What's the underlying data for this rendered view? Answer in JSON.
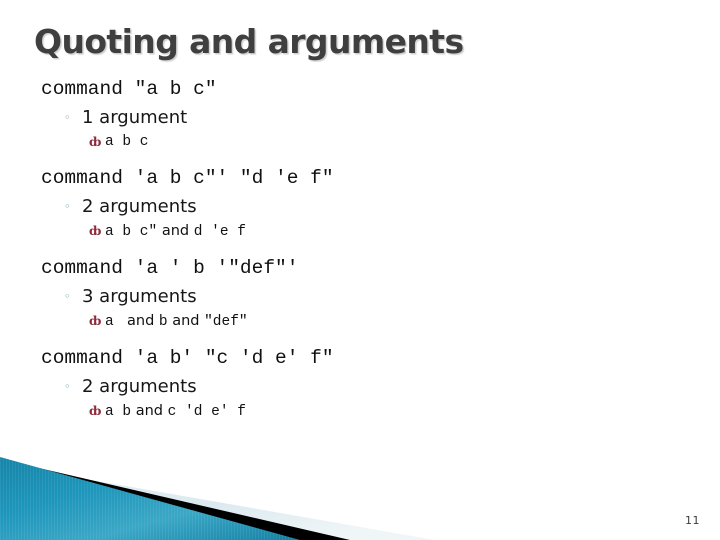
{
  "slide": {
    "title": "Quoting and arguments",
    "page_number": "11",
    "theme": {
      "title_color": "#3f3f3f",
      "body_color": "#111111",
      "bullet2_color": "#5f8fa0",
      "bullet3_color": "#8e2a39",
      "accent_teal": "#1a90b4",
      "accent_teal_dark": "#14708f",
      "accent_light": "#dbe8ee",
      "accent_black": "#000000",
      "background": "#ffffff"
    },
    "bullet_glyphs": {
      "level2": "◦",
      "level3": "ȸ"
    }
  },
  "blocks": [
    {
      "command": "command \"a b c\"",
      "count_label": "1 argument",
      "result_parts": [
        {
          "type": "code",
          "text": "a b c"
        }
      ]
    },
    {
      "command": "command 'a b c\"' \"d 'e f\"",
      "count_label": "2 arguments",
      "result_parts": [
        {
          "type": "code",
          "text": "a b c\""
        },
        {
          "type": "and",
          "text": " and "
        },
        {
          "type": "code",
          "text": "d 'e f"
        }
      ]
    },
    {
      "command": "command 'a ' b '\"def\"'",
      "count_label": "3 arguments",
      "result_parts": [
        {
          "type": "code",
          "text": "a "
        },
        {
          "type": "and",
          "text": " and "
        },
        {
          "type": "code",
          "text": "b"
        },
        {
          "type": "and",
          "text": " and "
        },
        {
          "type": "code",
          "text": "\"def\""
        }
      ]
    },
    {
      "command": "command 'a b' \"c 'd e' f\"",
      "count_label": "2 arguments",
      "result_parts": [
        {
          "type": "code",
          "text": "a b"
        },
        {
          "type": "and",
          "text": " and "
        },
        {
          "type": "code",
          "text": "c 'd e' f"
        }
      ]
    }
  ]
}
